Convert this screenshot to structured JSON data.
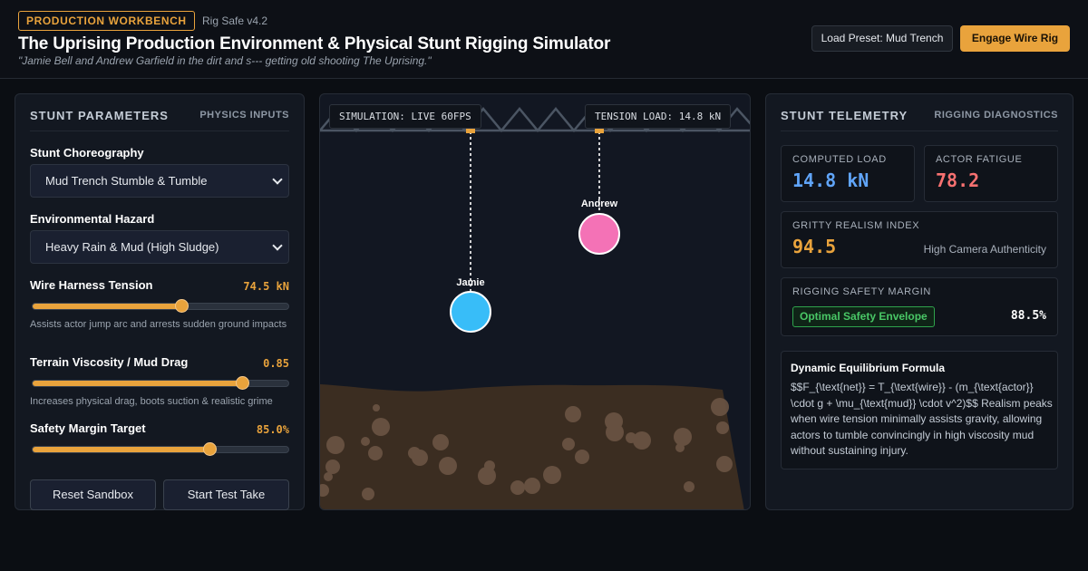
{
  "header": {
    "badge": "PRODUCTION WORKBENCH",
    "version": "Rig Safe v4.2",
    "title": "The Uprising Production Environment & Physical Stunt Rigging Simulator",
    "quote": "\"Jamie Bell and Andrew Garfield in the dirt and s--- getting old shooting The Uprising.\"",
    "preset_button": "Load Preset: Mud Trench",
    "engage_button": "Engage Wire Rig"
  },
  "params": {
    "title": "STUNT PARAMETERS",
    "subtitle": "PHYSICS INPUTS",
    "choreography_label": "Stunt Choreography",
    "choreography_value": "Mud Trench Stumble & Tumble",
    "hazard_label": "Environmental Hazard",
    "hazard_value": "Heavy Rain & Mud (High Sludge)",
    "tension_label": "Wire Harness Tension",
    "tension_value": "74.5 kN",
    "tension_fraction": 0.58,
    "tension_hint": "Assists actor jump arc and arrests sudden ground impacts",
    "viscosity_label": "Terrain Viscosity / Mud Drag",
    "viscosity_value": "0.85",
    "viscosity_fraction": 0.82,
    "viscosity_hint": "Increases physical drag, boots suction & realistic grime",
    "safety_label": "Safety Margin Target",
    "safety_value": "85.0%",
    "safety_fraction": 0.69,
    "reset_button": "Reset Sandbox",
    "test_button": "Start Test Take"
  },
  "simulation": {
    "status": "SIMULATION: LIVE 60FPS",
    "tension_load": "TENSION LOAD: 14.8 kN",
    "actor_a": "Jamie",
    "actor_b": "Andrew",
    "actor_a_color": "#38bdf8",
    "actor_b_color": "#f472b6"
  },
  "telemetry": {
    "title": "STUNT TELEMETRY",
    "subtitle": "RIGGING DIAGNOSTICS",
    "computed_load_label": "COMPUTED LOAD",
    "computed_load_value": "14.8 kN",
    "fatigue_label": "ACTOR FATIGUE",
    "fatigue_value": "78.2",
    "realism_label": "GRITTY REALISM INDEX",
    "realism_value": "94.5",
    "realism_note": "High Camera Authenticity",
    "safety_label": "RIGGING SAFETY MARGIN",
    "safety_badge": "Optimal Safety Envelope",
    "safety_value": "88.5%",
    "formula_title": "Dynamic Equilibrium Formula",
    "formula_body": "$$F_{\\text{net}} = T_{\\text{wire}} - (m_{\\text{actor}} \\cdot g + \\mu_{\\text{mud}} \\cdot v^2)$$ Realism peaks when wire tension minimally assists gravity, allowing actors to tumble convincingly in high viscosity mud without sustaining injury."
  },
  "colors": {
    "accent": "#e9a33c",
    "load_blue": "#60a5fa",
    "fatigue_red": "#f87171",
    "realism_amber": "#e9a33c",
    "safe_green": "#49c766"
  }
}
